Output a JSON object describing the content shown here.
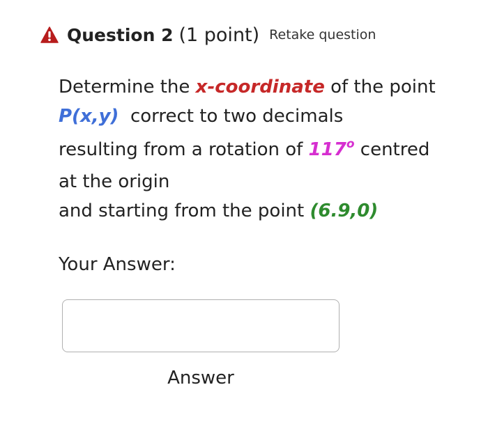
{
  "colors": {
    "warning": "#b71c1c",
    "x_coordinate": "#c62828",
    "point_p": "#3f6fd8",
    "angle": "#d62fd0",
    "start_point": "#2e8b2e"
  },
  "header": {
    "icon": "warning-triangle-icon",
    "title": "Question 2",
    "points": "(1 point)",
    "retake": "Retake question"
  },
  "question": {
    "lines": [
      [
        {
          "text": "Determine the "
        },
        {
          "text": "x-coordinate",
          "color": "#c62828"
        },
        {
          "text": " of the point"
        }
      ],
      [
        {
          "text": "P(x,y)",
          "color": "#3f6fd8"
        },
        {
          "text": "  correct to two decimals"
        }
      ],
      [
        {
          "text": "resulting from a rotation of "
        },
        {
          "text": "117",
          "color": "#d62fd0"
        },
        {
          "text": "o",
          "color": "#d62fd0",
          "sup": true
        },
        {
          "text": " centred"
        }
      ],
      [
        {
          "text": "at the origin"
        }
      ],
      [
        {
          "text": "and starting from the point "
        },
        {
          "text": "(6.9,0)",
          "color": "#2e8b2e"
        }
      ]
    ]
  },
  "answer": {
    "label": "Your Answer:",
    "value": "",
    "caption": "Answer"
  }
}
